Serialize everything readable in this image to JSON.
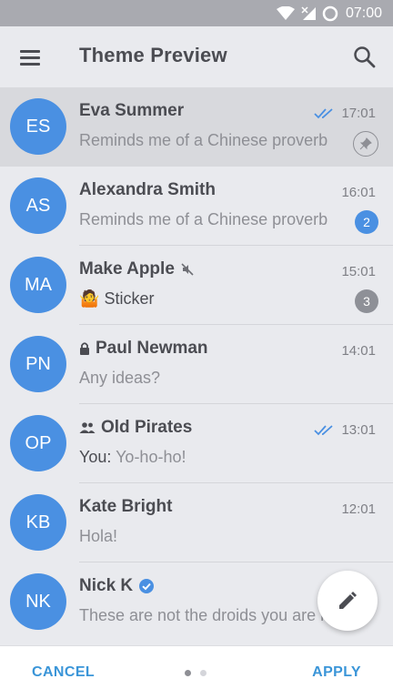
{
  "status_bar": {
    "time": "07:00"
  },
  "app_bar": {
    "title": "Theme Preview"
  },
  "chats": [
    {
      "initials": "ES",
      "name": "Eva Summer",
      "message": "Reminds me of a Chinese proverb",
      "time": "17:01",
      "read": true,
      "pinned": true
    },
    {
      "initials": "AS",
      "name": "Alexandra Smith",
      "message": "Reminds me of a Chinese proverb",
      "time": "16:01",
      "badge": "2",
      "badge_color": "#4a90e2"
    },
    {
      "initials": "MA",
      "name": "Make Apple",
      "muted": true,
      "message_emoji": "🤷",
      "message": "Sticker",
      "time": "15:01",
      "badge": "3",
      "badge_color": "#8e9097"
    },
    {
      "initials": "PN",
      "name": "Paul Newman",
      "locked": true,
      "message": "Any ideas?",
      "time": "14:01"
    },
    {
      "initials": "OP",
      "name": "Old Pirates",
      "group": true,
      "sender": "You:",
      "message": "Yo-ho-ho!",
      "time": "13:01",
      "read": true
    },
    {
      "initials": "KB",
      "name": "Kate Bright",
      "message": "Hola!",
      "time": "12:01"
    },
    {
      "initials": "NK",
      "name": "Nick K",
      "verified": true,
      "message": "These are not the droids you are looking for"
    }
  ],
  "bottom_bar": {
    "cancel_label": "CANCEL",
    "apply_label": "APPLY",
    "page_count": 2,
    "current_page": 1
  },
  "colors": {
    "accent": "#4a90e2",
    "action_text": "#3a95d8",
    "read_check": "#4a90e2"
  }
}
